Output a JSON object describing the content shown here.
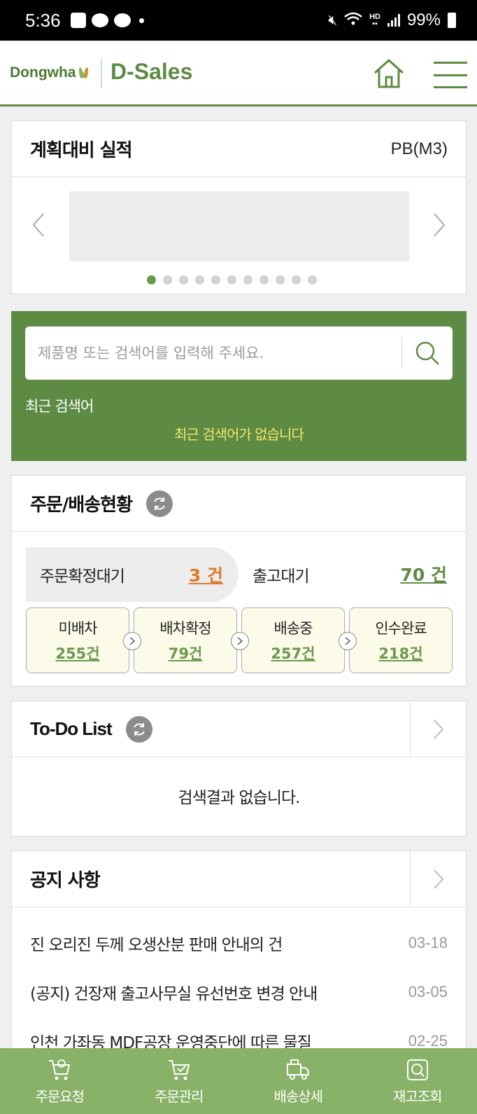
{
  "status_bar": {
    "time": "5:36",
    "battery": "99%"
  },
  "header": {
    "logo_text": "Dongwha",
    "app_name": "D-Sales"
  },
  "plan_card": {
    "title": "계획대비 실적",
    "unit": "PB(M3)",
    "dots_total": 11,
    "active_dot": 0
  },
  "search": {
    "placeholder": "제품명 또는 검색어를 입력해 주세요.",
    "recent_label": "최근 검색어",
    "recent_empty": "최근 검색어가 없습니다"
  },
  "order": {
    "title": "주문/배송현황",
    "pending_label": "주문확정대기",
    "pending_count": "3 건",
    "wait_label": "출고대기",
    "wait_count": "70 건",
    "steps": [
      {
        "label": "미배차",
        "count": "255건"
      },
      {
        "label": "배차확정",
        "count": "79건"
      },
      {
        "label": "배송중",
        "count": "257건"
      },
      {
        "label": "인수완료",
        "count": "218건"
      }
    ]
  },
  "todo": {
    "title": "To-Do List",
    "empty": "검색결과 없습니다."
  },
  "notice": {
    "title": "공지 사항",
    "items": [
      {
        "title": "진 오리진 두께 오생산분 판매 안내의 건",
        "date": "03-18"
      },
      {
        "title": "(공지) 건장재 출고사무실 유선번호 변경 안내",
        "date": "03-05"
      },
      {
        "title": "인천 가좌동 MDF공장 운영중단에 따른 물질",
        "date": "02-25"
      }
    ]
  },
  "bottom_nav": [
    {
      "label": "주문요청",
      "icon": "cart-icon"
    },
    {
      "label": "주문관리",
      "icon": "cart-check-icon"
    },
    {
      "label": "배송상세",
      "icon": "truck-icon"
    },
    {
      "label": "재고조회",
      "icon": "inventory-search-icon"
    }
  ],
  "colors": {
    "brand": "#5d8b43",
    "bottom_nav": "#88b267",
    "accent_orange": "#e07a2e",
    "highlight_yellow": "#f2e56a"
  }
}
